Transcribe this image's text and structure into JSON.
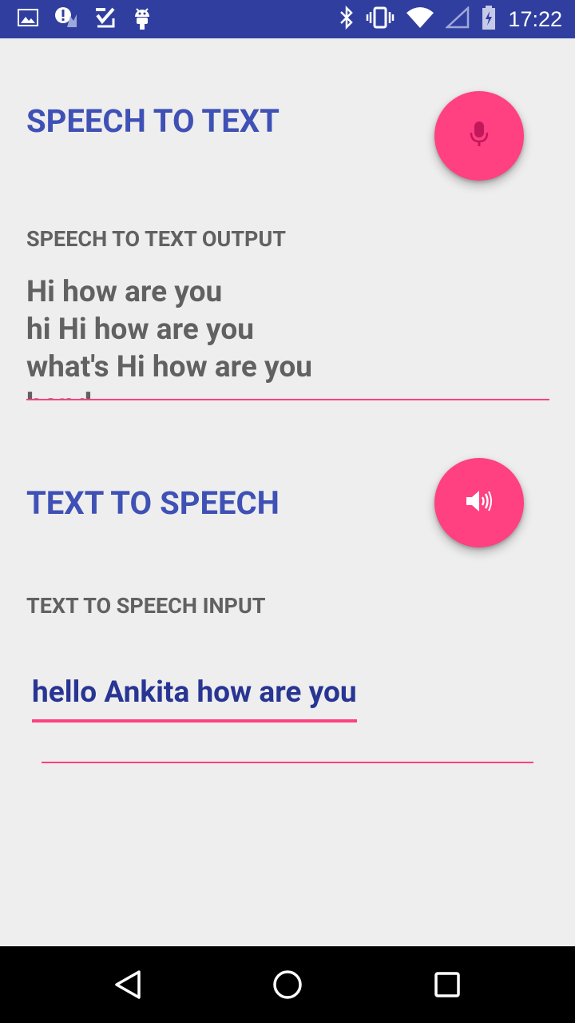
{
  "status_bar": {
    "time": "17:22",
    "left_icons": [
      "image-icon",
      "alert-icon",
      "check-icon",
      "android-icon"
    ],
    "right_icons": [
      "bluetooth-icon",
      "vibrate-icon",
      "wifi-icon",
      "signal-icon",
      "battery-icon"
    ]
  },
  "speech_to_text": {
    "title": "SPEECH TO TEXT",
    "button_icon": "mic-icon",
    "output_label": "SPEECH TO TEXT OUTPUT",
    "output_lines": [
      "Hi how are you",
      "hi Hi how are you",
      "what's Hi how are you",
      "hand"
    ]
  },
  "text_to_speech": {
    "title": "TEXT TO SPEECH",
    "button_icon": "speaker-icon",
    "input_label": "TEXT TO SPEECH INPUT",
    "input_value": "hello Ankita how are you"
  },
  "nav_bar": {
    "icons": [
      "back-icon",
      "home-icon",
      "recents-icon"
    ]
  },
  "colors": {
    "primary_dark": "#303f9f",
    "primary": "#3f51b5",
    "accent": "#ff4081",
    "background": "#eeeeee"
  }
}
